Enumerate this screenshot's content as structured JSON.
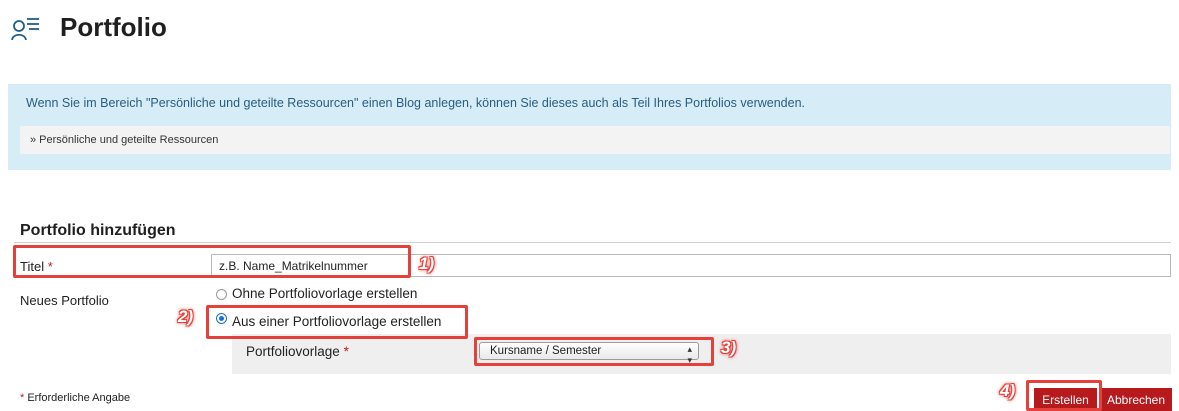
{
  "header": {
    "title": "Portfolio",
    "icon": "user-list-icon"
  },
  "info": {
    "text": "Wenn Sie im Bereich \"Persönliche und geteilte Ressourcen\" einen Blog anlegen, können Sie dieses auch als Teil Ihres Portfolios verwenden.",
    "link_label": "» Persönliche und geteilte Ressourcen"
  },
  "form": {
    "heading": "Portfolio hinzufügen",
    "titel_label": "Titel",
    "required_mark": "*",
    "titel_value": "z.B. Name_Matrikelnummer",
    "neues_label": "Neues Portfolio",
    "options": [
      {
        "label": "Ohne Portfoliovorlage erstellen",
        "selected": false
      },
      {
        "label": "Aus einer Portfoliovorlage erstellen",
        "selected": true
      }
    ],
    "vorlage_label": "Portfoliovorlage",
    "vorlage_value": "Kursname / Semester",
    "required_note": "Erforderliche Angabe",
    "create_label": "Erstellen",
    "cancel_label": "Abbrechen"
  },
  "annotations": {
    "badge_1": "1)",
    "badge_2": "2)",
    "badge_3": "3)",
    "badge_4": "4)"
  },
  "colors": {
    "accent_red": "#b71a1d",
    "info_bg": "#d6ecf6",
    "annotation": "#e5403a"
  }
}
